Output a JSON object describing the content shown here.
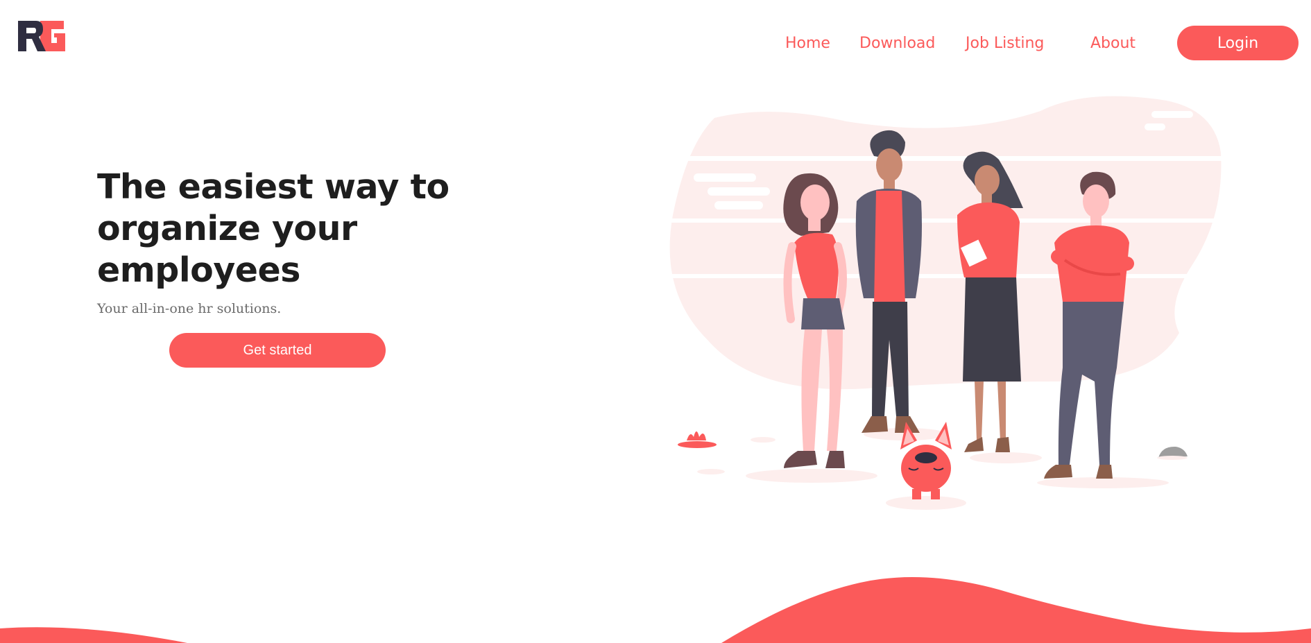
{
  "brand": {
    "logo_text": "RG",
    "accent_color": "#fb5a5a",
    "dark_color": "#2f2e41"
  },
  "nav": {
    "items": [
      {
        "label": "Home"
      },
      {
        "label": "Download"
      },
      {
        "label": "Job Listing"
      },
      {
        "label": "About"
      }
    ],
    "login_label": "Login"
  },
  "hero": {
    "title": "The easiest way to organize your employees",
    "subtitle": "Your all-in-one hr solutions.",
    "cta_label": "Get started"
  },
  "icons": [
    "logo-icon",
    "team-illustration",
    "dog-illustration"
  ]
}
